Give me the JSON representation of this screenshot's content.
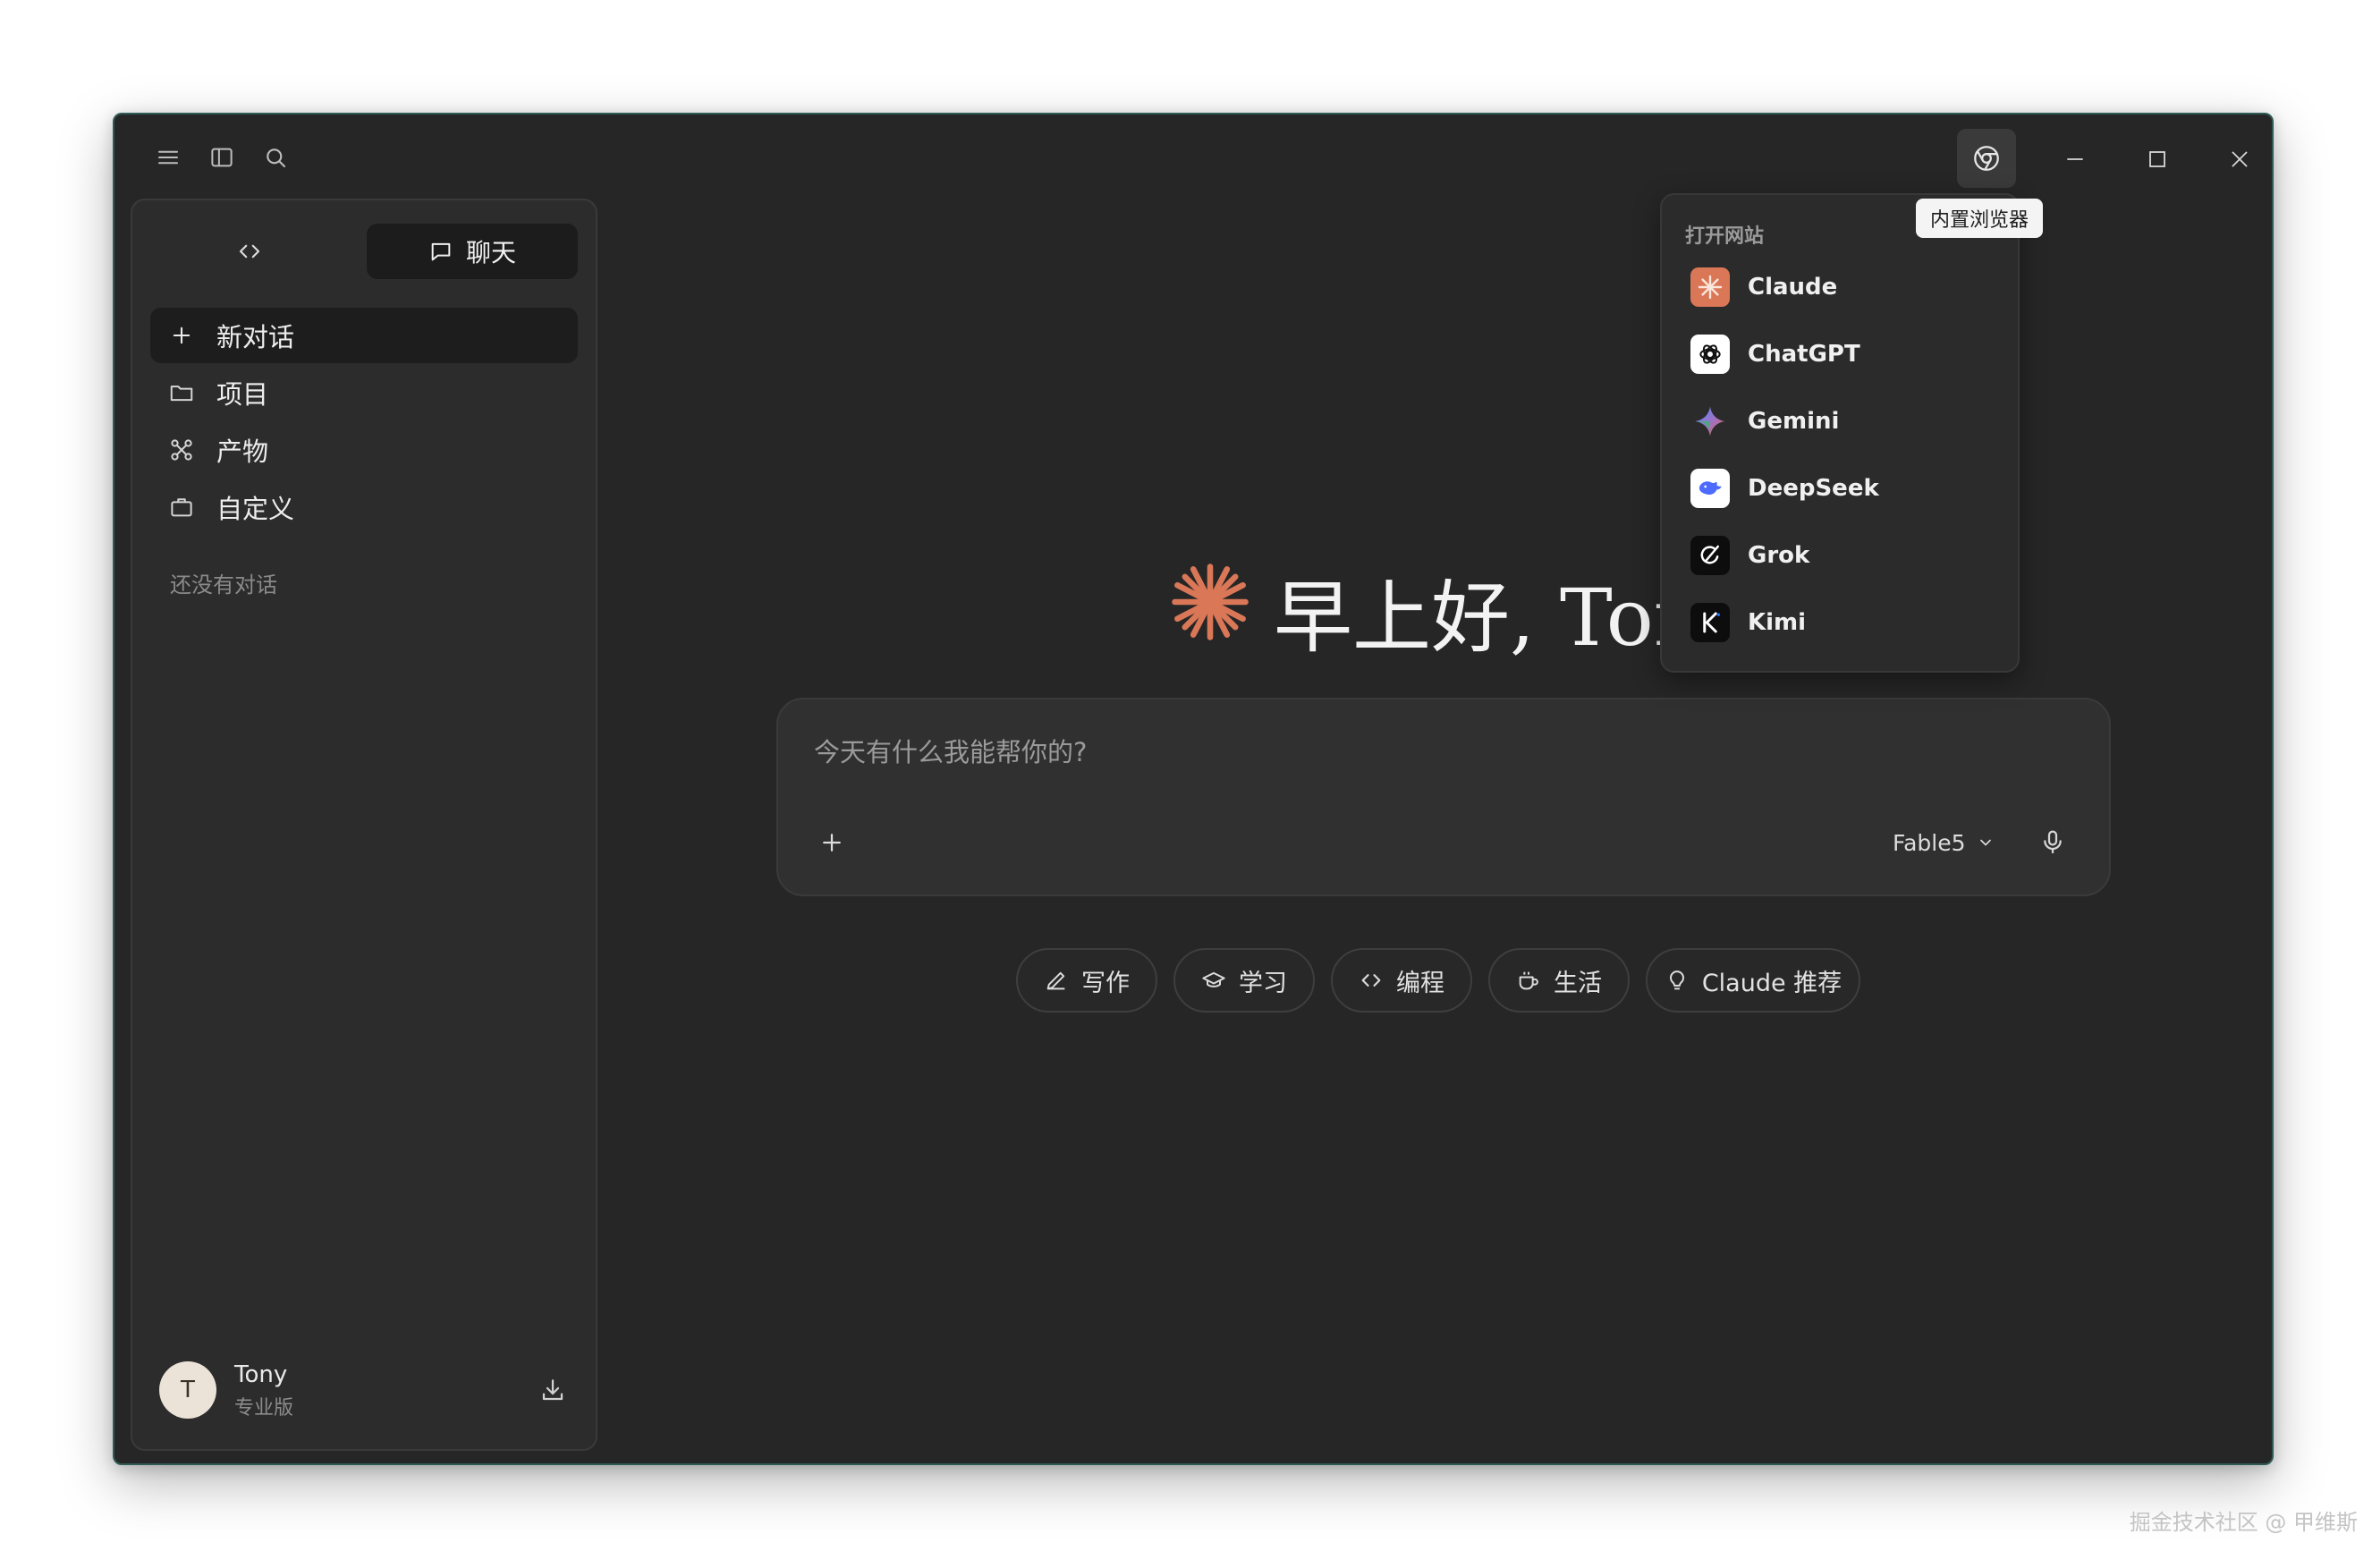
{
  "titlebar": {
    "tooltip": "内置浏览器"
  },
  "sidebar": {
    "segments": [
      {
        "label": ""
      },
      {
        "label": "聊天"
      }
    ],
    "items": [
      {
        "label": "新对话",
        "icon": "plus-icon"
      },
      {
        "label": "项目",
        "icon": "folder-icon"
      },
      {
        "label": "产物",
        "icon": "command-icon"
      },
      {
        "label": "自定义",
        "icon": "briefcase-icon"
      }
    ],
    "empty_hint": "还没有对话",
    "user": {
      "initial": "T",
      "name": "Tony",
      "plan": "专业版"
    }
  },
  "main": {
    "greeting": "早上好, Tony",
    "composer": {
      "placeholder": "今天有什么我能帮你的?",
      "model": "Fable5"
    },
    "chips": [
      {
        "label": "写作",
        "icon": "pen-icon"
      },
      {
        "label": "学习",
        "icon": "graduation-cap-icon"
      },
      {
        "label": "编程",
        "icon": "code-icon"
      },
      {
        "label": "生活",
        "icon": "coffee-icon"
      },
      {
        "label": "Claude 推荐",
        "icon": "lightbulb-icon"
      }
    ]
  },
  "dropdown": {
    "title": "打开网站",
    "items": [
      {
        "label": "Claude",
        "icon": "claude-logo"
      },
      {
        "label": "ChatGPT",
        "icon": "chatgpt-logo"
      },
      {
        "label": "Gemini",
        "icon": "gemini-logo"
      },
      {
        "label": "DeepSeek",
        "icon": "deepseek-logo"
      },
      {
        "label": "Grok",
        "icon": "grok-logo"
      },
      {
        "label": "Kimi",
        "icon": "kimi-logo"
      }
    ]
  },
  "colors": {
    "background": "#262626",
    "accent": "#d97757",
    "sidebar": "#2c2c2c"
  },
  "watermark": "掘金技术社区 @ 甲维斯"
}
